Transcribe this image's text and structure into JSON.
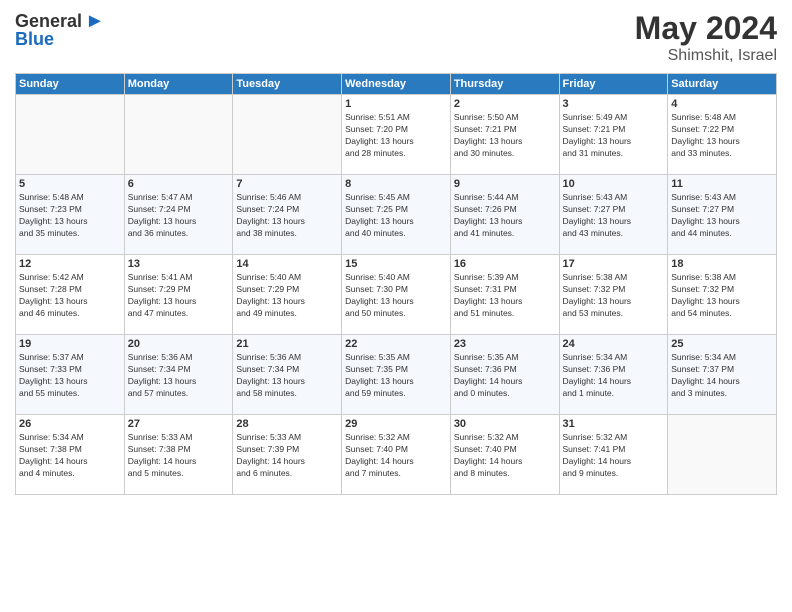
{
  "header": {
    "logo_general": "General",
    "logo_blue": "Blue",
    "title": "May 2024",
    "location": "Shimshit, Israel"
  },
  "weekdays": [
    "Sunday",
    "Monday",
    "Tuesday",
    "Wednesday",
    "Thursday",
    "Friday",
    "Saturday"
  ],
  "weeks": [
    [
      {
        "day": "",
        "info": ""
      },
      {
        "day": "",
        "info": ""
      },
      {
        "day": "",
        "info": ""
      },
      {
        "day": "1",
        "info": "Sunrise: 5:51 AM\nSunset: 7:20 PM\nDaylight: 13 hours\nand 28 minutes."
      },
      {
        "day": "2",
        "info": "Sunrise: 5:50 AM\nSunset: 7:21 PM\nDaylight: 13 hours\nand 30 minutes."
      },
      {
        "day": "3",
        "info": "Sunrise: 5:49 AM\nSunset: 7:21 PM\nDaylight: 13 hours\nand 31 minutes."
      },
      {
        "day": "4",
        "info": "Sunrise: 5:48 AM\nSunset: 7:22 PM\nDaylight: 13 hours\nand 33 minutes."
      }
    ],
    [
      {
        "day": "5",
        "info": "Sunrise: 5:48 AM\nSunset: 7:23 PM\nDaylight: 13 hours\nand 35 minutes."
      },
      {
        "day": "6",
        "info": "Sunrise: 5:47 AM\nSunset: 7:24 PM\nDaylight: 13 hours\nand 36 minutes."
      },
      {
        "day": "7",
        "info": "Sunrise: 5:46 AM\nSunset: 7:24 PM\nDaylight: 13 hours\nand 38 minutes."
      },
      {
        "day": "8",
        "info": "Sunrise: 5:45 AM\nSunset: 7:25 PM\nDaylight: 13 hours\nand 40 minutes."
      },
      {
        "day": "9",
        "info": "Sunrise: 5:44 AM\nSunset: 7:26 PM\nDaylight: 13 hours\nand 41 minutes."
      },
      {
        "day": "10",
        "info": "Sunrise: 5:43 AM\nSunset: 7:27 PM\nDaylight: 13 hours\nand 43 minutes."
      },
      {
        "day": "11",
        "info": "Sunrise: 5:43 AM\nSunset: 7:27 PM\nDaylight: 13 hours\nand 44 minutes."
      }
    ],
    [
      {
        "day": "12",
        "info": "Sunrise: 5:42 AM\nSunset: 7:28 PM\nDaylight: 13 hours\nand 46 minutes."
      },
      {
        "day": "13",
        "info": "Sunrise: 5:41 AM\nSunset: 7:29 PM\nDaylight: 13 hours\nand 47 minutes."
      },
      {
        "day": "14",
        "info": "Sunrise: 5:40 AM\nSunset: 7:29 PM\nDaylight: 13 hours\nand 49 minutes."
      },
      {
        "day": "15",
        "info": "Sunrise: 5:40 AM\nSunset: 7:30 PM\nDaylight: 13 hours\nand 50 minutes."
      },
      {
        "day": "16",
        "info": "Sunrise: 5:39 AM\nSunset: 7:31 PM\nDaylight: 13 hours\nand 51 minutes."
      },
      {
        "day": "17",
        "info": "Sunrise: 5:38 AM\nSunset: 7:32 PM\nDaylight: 13 hours\nand 53 minutes."
      },
      {
        "day": "18",
        "info": "Sunrise: 5:38 AM\nSunset: 7:32 PM\nDaylight: 13 hours\nand 54 minutes."
      }
    ],
    [
      {
        "day": "19",
        "info": "Sunrise: 5:37 AM\nSunset: 7:33 PM\nDaylight: 13 hours\nand 55 minutes."
      },
      {
        "day": "20",
        "info": "Sunrise: 5:36 AM\nSunset: 7:34 PM\nDaylight: 13 hours\nand 57 minutes."
      },
      {
        "day": "21",
        "info": "Sunrise: 5:36 AM\nSunset: 7:34 PM\nDaylight: 13 hours\nand 58 minutes."
      },
      {
        "day": "22",
        "info": "Sunrise: 5:35 AM\nSunset: 7:35 PM\nDaylight: 13 hours\nand 59 minutes."
      },
      {
        "day": "23",
        "info": "Sunrise: 5:35 AM\nSunset: 7:36 PM\nDaylight: 14 hours\nand 0 minutes."
      },
      {
        "day": "24",
        "info": "Sunrise: 5:34 AM\nSunset: 7:36 PM\nDaylight: 14 hours\nand 1 minute."
      },
      {
        "day": "25",
        "info": "Sunrise: 5:34 AM\nSunset: 7:37 PM\nDaylight: 14 hours\nand 3 minutes."
      }
    ],
    [
      {
        "day": "26",
        "info": "Sunrise: 5:34 AM\nSunset: 7:38 PM\nDaylight: 14 hours\nand 4 minutes."
      },
      {
        "day": "27",
        "info": "Sunrise: 5:33 AM\nSunset: 7:38 PM\nDaylight: 14 hours\nand 5 minutes."
      },
      {
        "day": "28",
        "info": "Sunrise: 5:33 AM\nSunset: 7:39 PM\nDaylight: 14 hours\nand 6 minutes."
      },
      {
        "day": "29",
        "info": "Sunrise: 5:32 AM\nSunset: 7:40 PM\nDaylight: 14 hours\nand 7 minutes."
      },
      {
        "day": "30",
        "info": "Sunrise: 5:32 AM\nSunset: 7:40 PM\nDaylight: 14 hours\nand 8 minutes."
      },
      {
        "day": "31",
        "info": "Sunrise: 5:32 AM\nSunset: 7:41 PM\nDaylight: 14 hours\nand 9 minutes."
      },
      {
        "day": "",
        "info": ""
      }
    ]
  ]
}
